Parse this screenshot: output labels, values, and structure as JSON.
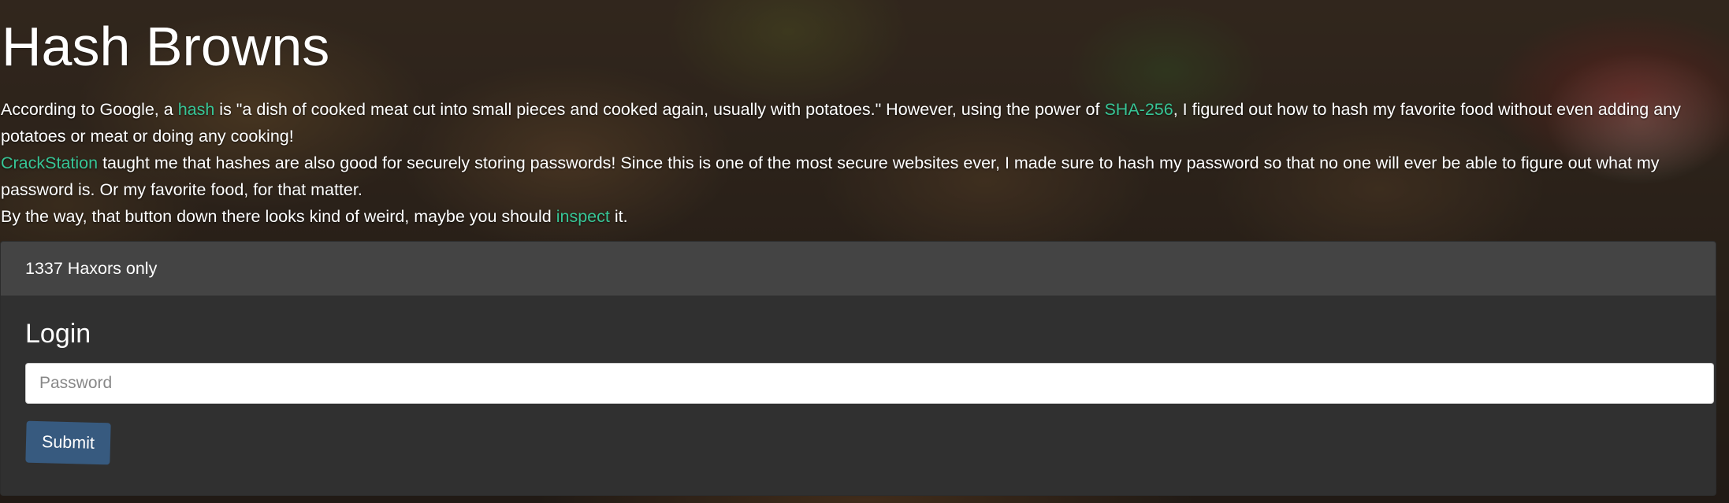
{
  "page": {
    "title": "Hash Browns"
  },
  "intro": {
    "p1_a": "According to Google, a ",
    "p1_link_hash": "hash",
    "p1_b": " is \"a dish of cooked meat cut into small pieces and cooked again, usually with potatoes.\" However, using the power of ",
    "p1_link_sha": "SHA-256",
    "p1_c": ", I figured out how to hash my favorite food without even adding any potatoes or meat or doing any cooking!",
    "p2_link_crackstation": "CrackStation",
    "p2_a": " taught me that hashes are also good for securely storing passwords! Since this is one of the most secure websites ever, I made sure to hash my password so that no one will ever be able to figure out what my password is. Or my favorite food, for that matter.",
    "p3_a": "By the way, that button down there looks kind of weird, maybe you should ",
    "p3_link_inspect": "inspect",
    "p3_b": " it."
  },
  "card": {
    "header": "1337 Haxors only",
    "title": "Login",
    "password_placeholder": "Password",
    "password_value": "",
    "submit_label": "Submit"
  },
  "colors": {
    "link": "#37c596",
    "button": "#375a7f",
    "card_header_bg": "#444444",
    "card_body_bg": "#303030"
  }
}
